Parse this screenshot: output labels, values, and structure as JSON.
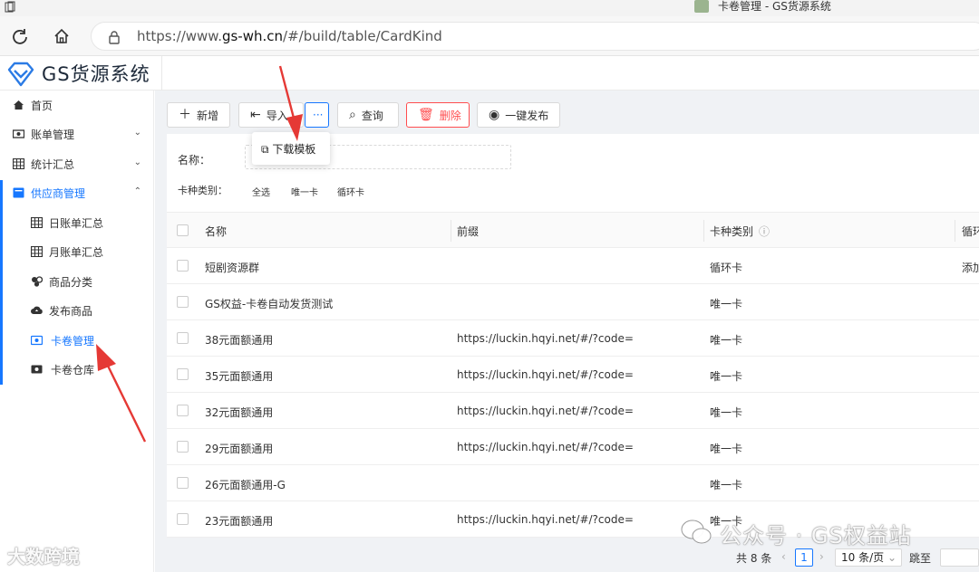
{
  "browser": {
    "tab_title": "卡卷管理 - GS货源系统",
    "url_prefix": "https://www.",
    "url_host": "gs-wh.cn",
    "url_path": "/#/build/table/CardKind"
  },
  "app": {
    "title": "GS货源系统"
  },
  "sidebar": {
    "items": [
      {
        "label": "首页",
        "icon": "home-icon"
      },
      {
        "label": "账单管理",
        "icon": "bill-icon"
      },
      {
        "label": "统计汇总",
        "icon": "grid-icon"
      },
      {
        "label": "供应商管理",
        "icon": "supplier-icon"
      },
      {
        "label": "日账单汇总",
        "icon": "grid-icon"
      },
      {
        "label": "月账单汇总",
        "icon": "grid-icon"
      },
      {
        "label": "商品分类",
        "icon": "category-icon"
      },
      {
        "label": "发布商品",
        "icon": "cloud-upload-icon"
      },
      {
        "label": "卡卷管理",
        "icon": "card-icon"
      },
      {
        "label": "卡卷仓库",
        "icon": "card-icon"
      }
    ]
  },
  "toolbar": {
    "add": "新增",
    "import": "导入",
    "more": "···",
    "query": "查询",
    "delete": "删除",
    "publish": "一键发布"
  },
  "dropdown": {
    "download_template": "下载模板"
  },
  "filter": {
    "name_label": "名称：",
    "kind_label": "卡种类别：",
    "kind_options": [
      "全选",
      "唯一卡",
      "循环卡"
    ]
  },
  "table": {
    "columns": [
      "名称",
      "前缀",
      "卡种类别",
      "循环"
    ],
    "rows": [
      {
        "name": "短剧资源群",
        "prefix": "",
        "kind": "循环卡",
        "extra": "添加"
      },
      {
        "name": "GS权益-卡卷自动发货测试",
        "prefix": "",
        "kind": "唯一卡",
        "extra": ""
      },
      {
        "name": "38元面额通用",
        "prefix": "https://luckin.hqyi.net/#/?code=",
        "kind": "唯一卡",
        "extra": ""
      },
      {
        "name": "35元面额通用",
        "prefix": "https://luckin.hqyi.net/#/?code=",
        "kind": "唯一卡",
        "extra": ""
      },
      {
        "name": "32元面额通用",
        "prefix": "https://luckin.hqyi.net/#/?code=",
        "kind": "唯一卡",
        "extra": ""
      },
      {
        "name": "29元面额通用",
        "prefix": "https://luckin.hqyi.net/#/?code=",
        "kind": "唯一卡",
        "extra": ""
      },
      {
        "name": "26元面额通用-G",
        "prefix": "",
        "kind": "唯一卡",
        "extra": ""
      },
      {
        "name": "23元面额通用",
        "prefix": "https://luckin.hqyi.net/#/?code=",
        "kind": "唯一卡",
        "extra": ""
      }
    ]
  },
  "pagination": {
    "total": "共 8 条",
    "current": "1",
    "page_size": "10 条/页",
    "jump": "跳至"
  },
  "watermarks": {
    "left": "大数跨境",
    "right": "公众号 · GS权益站"
  },
  "colors": {
    "primary": "#1677ff",
    "danger": "#ff4d4f",
    "arrow": "#e53935"
  }
}
